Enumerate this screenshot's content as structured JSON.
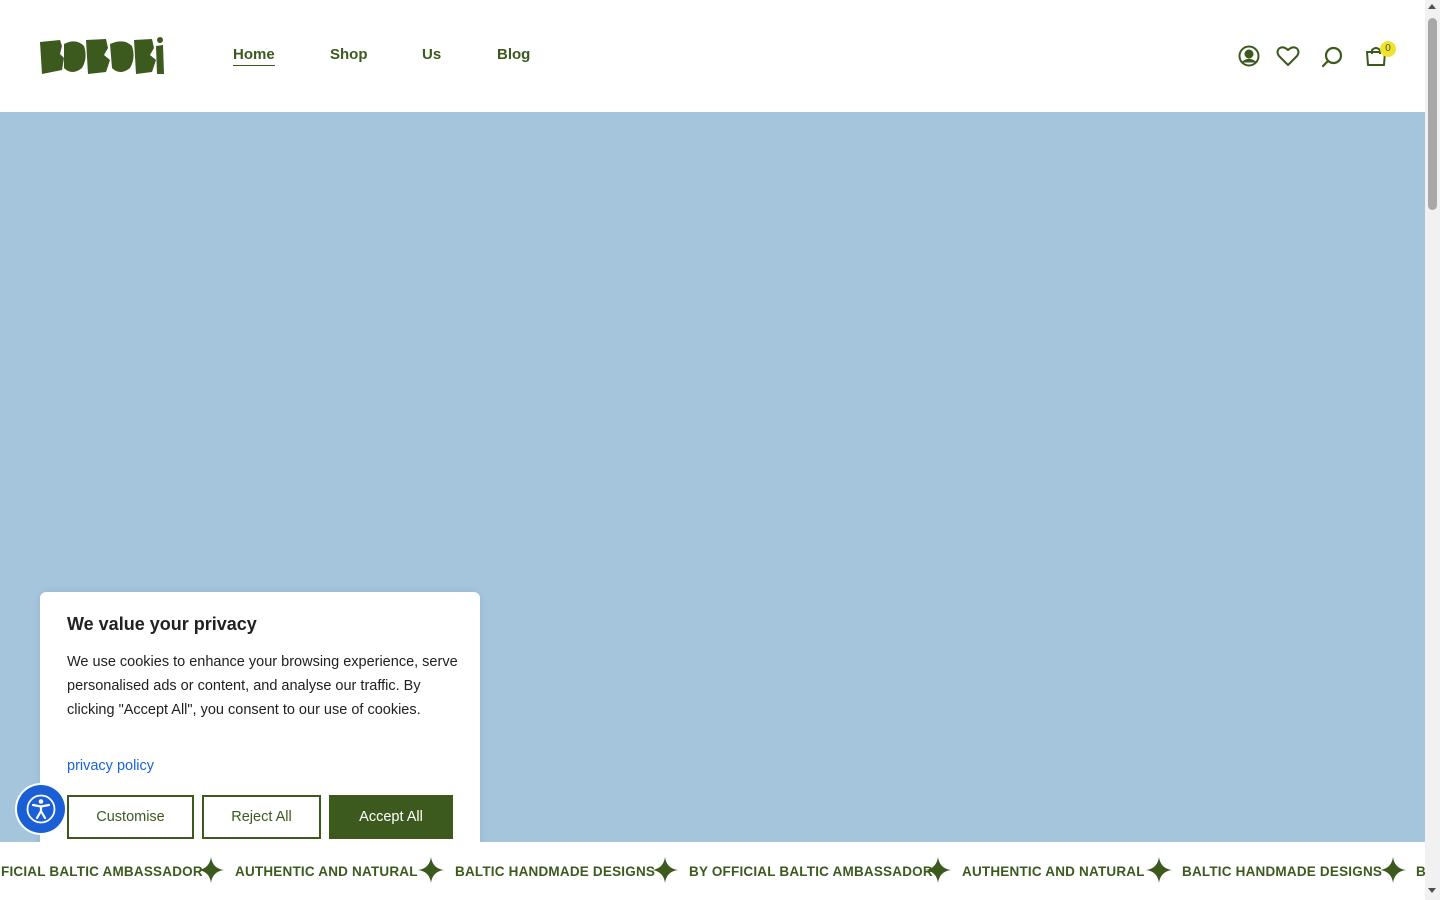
{
  "header": {
    "brand": "BOBOBI",
    "nav": [
      {
        "label": "Home",
        "active": true
      },
      {
        "label": "Shop",
        "active": false
      },
      {
        "label": "Us",
        "active": false
      },
      {
        "label": "Blog",
        "active": false
      }
    ],
    "icons": [
      "account-icon",
      "wishlist-heart-icon",
      "search-icon",
      "cart-bag-icon"
    ],
    "cart_count": "0"
  },
  "hero": {
    "background": "#a5c5dc"
  },
  "cookie_banner": {
    "title": "We value your privacy",
    "body": "We use cookies to enhance your browsing experience, serve personalised ads or content, and analyse our traffic. By clicking \"Accept All\", you consent to our use of cookies.",
    "policy_link": "privacy policy",
    "buttons": {
      "customise": "Customise",
      "reject": "Reject All",
      "accept": "Accept All"
    }
  },
  "marquee": {
    "items": [
      "FICIAL BALTIC AMBASSADOR",
      "AUTHENTIC AND NATURAL",
      "BALTIC HANDMADE DESIGNS",
      "BY OFFICIAL BALTIC AMBASSADOR",
      "AUTHENTIC AND NATURAL",
      "BALTIC HANDMADE DESIGNS",
      "B"
    ]
  },
  "colors": {
    "brand_green": "#3c5a1e",
    "hero_blue": "#a5c5dc",
    "badge_yellow": "#f2e230",
    "link_blue": "#1863dc",
    "a11y_blue": "#1a5fd6"
  }
}
